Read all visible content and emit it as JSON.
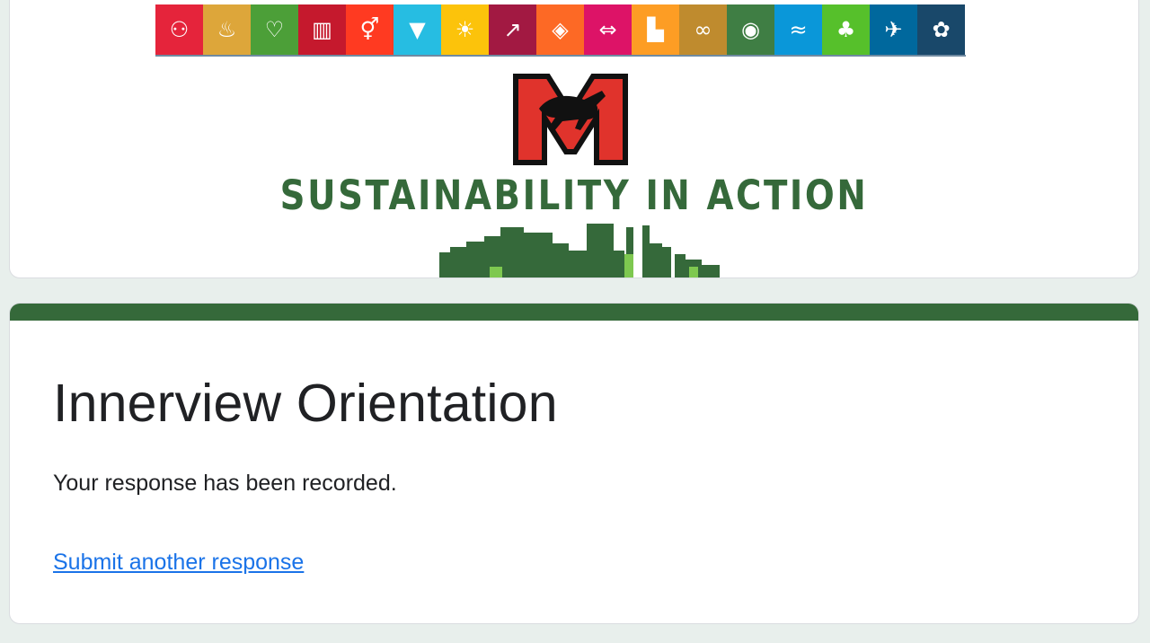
{
  "header": {
    "sdg_tiles": [
      {
        "icon": "people-icon",
        "glyph": "⚇",
        "color": "#e5243b"
      },
      {
        "icon": "bowl-icon",
        "glyph": "♨",
        "color": "#dda63a"
      },
      {
        "icon": "heartbeat-icon",
        "glyph": "♡",
        "color": "#4c9f38"
      },
      {
        "icon": "book-icon",
        "glyph": "▥",
        "color": "#c5192d"
      },
      {
        "icon": "gender-icon",
        "glyph": "⚥",
        "color": "#ff3a21"
      },
      {
        "icon": "water-drop-icon",
        "glyph": "▼",
        "color": "#26bde2"
      },
      {
        "icon": "sun-icon",
        "glyph": "☀",
        "color": "#fcc30b"
      },
      {
        "icon": "growth-chart-icon",
        "glyph": "↗",
        "color": "#a21942"
      },
      {
        "icon": "cubes-icon",
        "glyph": "◈",
        "color": "#fd6925"
      },
      {
        "icon": "equality-icon",
        "glyph": "⇔",
        "color": "#dd1367"
      },
      {
        "icon": "city-icon",
        "glyph": "▙",
        "color": "#fd9d24"
      },
      {
        "icon": "infinity-icon",
        "glyph": "∞",
        "color": "#bf8b2e"
      },
      {
        "icon": "eye-globe-icon",
        "glyph": "◉",
        "color": "#3f7e44"
      },
      {
        "icon": "fish-icon",
        "glyph": "≈",
        "color": "#0a97d9"
      },
      {
        "icon": "tree-icon",
        "glyph": "♣",
        "color": "#56c02b"
      },
      {
        "icon": "dove-icon",
        "glyph": "✈",
        "color": "#00689d"
      },
      {
        "icon": "flower-icon",
        "glyph": "✿",
        "color": "#19486a"
      }
    ],
    "banner_text": "SUSTAINABILITY IN ACTION",
    "logo": {
      "icon": "mustang-m-logo-icon",
      "fill": "#e0332c",
      "outline": "#111111"
    },
    "banner_color": "#35693a"
  },
  "form": {
    "accent_color": "#35693a",
    "title": "Innerview Orientation",
    "confirmation_message": "Your response has been recorded.",
    "submit_another_label": "Submit another response"
  }
}
